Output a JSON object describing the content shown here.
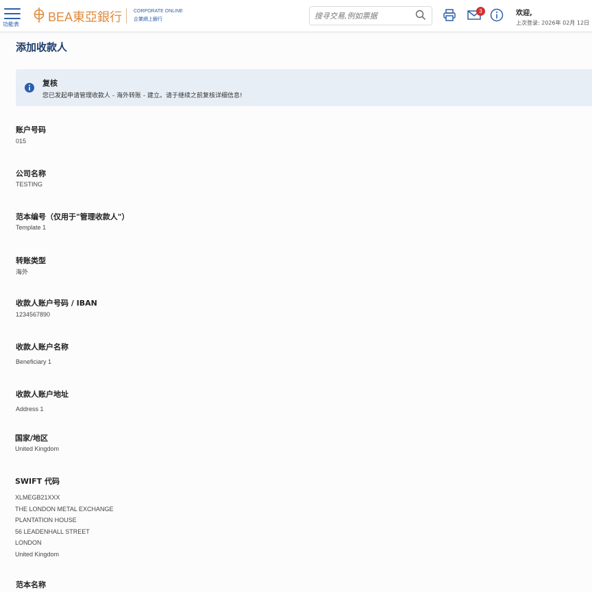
{
  "header": {
    "menu_label": "功能表",
    "logo_text": "BEA東亞銀行",
    "logo_sub_en": "CORPORATE ONLINE",
    "logo_sub_zh": "企業網上銀行",
    "search_placeholder": "搜寻交易,例如票据",
    "message_count": "3",
    "welcome": "欢迎,",
    "last_login": "上次登录: 2026年 02月 12日"
  },
  "page": {
    "title": "添加收款人"
  },
  "alert": {
    "title": "复核",
    "text": "您已发起申请管理收款人 - 海外转账 - 建立。请于继续之前复核详细信息!"
  },
  "fields": [
    {
      "label": "账户号码",
      "value": "015"
    },
    {
      "label": "公司名称",
      "value": "TESTING"
    },
    {
      "label": "范本编号（仅用于\"管理收款人\"）",
      "value": "Template 1"
    },
    {
      "label": "转账类型",
      "value": "海外"
    },
    {
      "label": "收款人账户号码 / IBAN",
      "value": "1234567890"
    },
    {
      "label": "收款人账户名称",
      "value": "Beneficiary 1"
    },
    {
      "label": "收款人账户地址",
      "value": "Address 1"
    },
    {
      "label": "国家/地区",
      "value": "United Kingdom"
    }
  ],
  "swift": {
    "label": "SWIFT 代码",
    "lines": [
      "XLMEGB21XXX",
      "THE LONDON METAL EXCHANGE",
      "PLANTATION HOUSE",
      "56 LEADENHALL STREET",
      "LONDON",
      "United Kingdom"
    ]
  },
  "template_name": {
    "label": "范本名称"
  },
  "colors": {
    "primary": "#2b5fa8",
    "title": "#1e3d6b",
    "brand_orange": "#e08a3c",
    "alert_bg": "#e8eef6",
    "badge": "#d32f2f"
  }
}
